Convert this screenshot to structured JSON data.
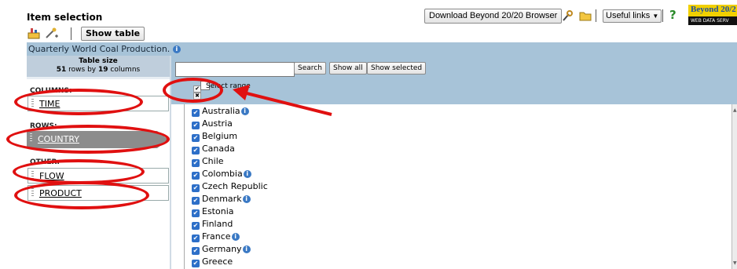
{
  "header": {
    "title": "Item selection",
    "download_label": "Download Beyond 20/20 Browser",
    "useful_links_label": "Useful links",
    "logo_line1": "Beyond 20/2",
    "logo_line2": "WEB DATA SERV"
  },
  "toolbar": {
    "show_table_label": "Show table"
  },
  "titlebar": {
    "text": "Quarterly World Coal Production."
  },
  "table_size": {
    "heading": "Table size",
    "rows": "51",
    "rows_suffix": " rows by ",
    "cols": "19",
    "cols_suffix": " columns"
  },
  "dimensions": {
    "columns_label": "COLUMNS:",
    "columns_item": "TIME",
    "rows_label": "ROWS:",
    "rows_item": "COUNTRY",
    "other_label": "OTHER:",
    "other_items": [
      "FLOW",
      "PRODUCT"
    ]
  },
  "controls": {
    "search_label": "Search",
    "show_all_label": "Show all",
    "show_selected_label": "Show selected",
    "select_range_label": "Select range"
  },
  "countries": [
    {
      "name": "Australia",
      "info": true
    },
    {
      "name": "Austria",
      "info": false
    },
    {
      "name": "Belgium",
      "info": false
    },
    {
      "name": "Canada",
      "info": false
    },
    {
      "name": "Chile",
      "info": false
    },
    {
      "name": "Colombia",
      "info": true
    },
    {
      "name": "Czech Republic",
      "info": false
    },
    {
      "name": "Denmark",
      "info": true
    },
    {
      "name": "Estonia",
      "info": false
    },
    {
      "name": "Finland",
      "info": false
    },
    {
      "name": "France",
      "info": true
    },
    {
      "name": "Germany",
      "info": true
    },
    {
      "name": "Greece",
      "info": false
    }
  ],
  "colors": {
    "accent_annotation": "#e01010",
    "panel_blue": "#a7c3d8",
    "checkbox_blue": "#2d6fc8"
  }
}
